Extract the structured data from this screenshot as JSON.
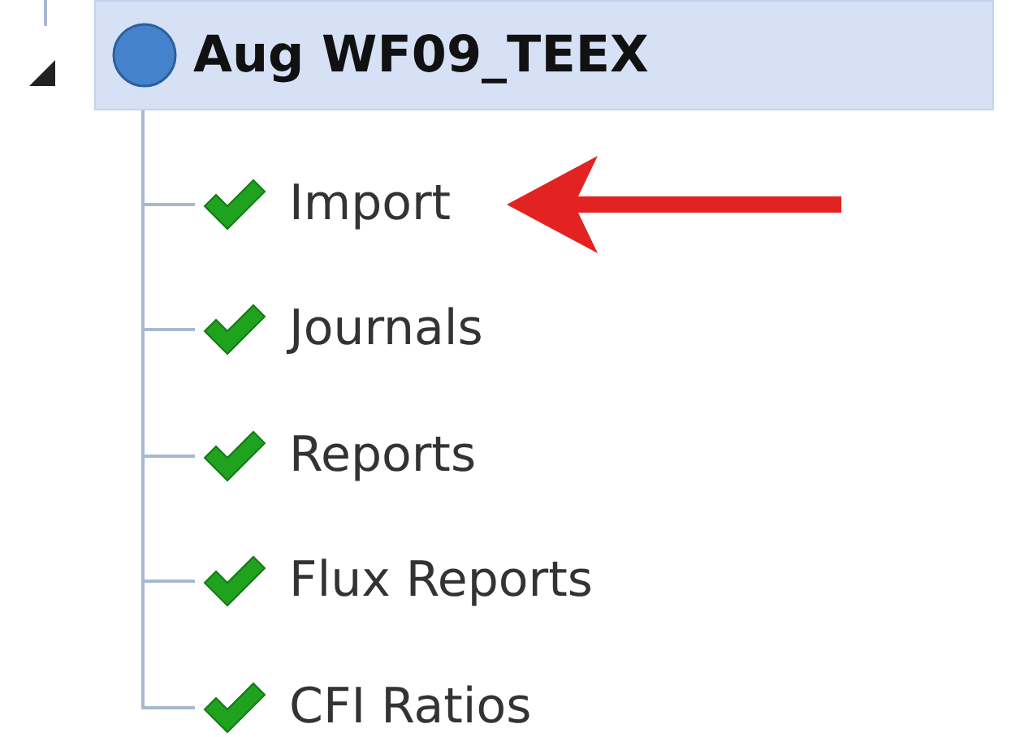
{
  "tree": {
    "label": "Aug WF09_TEEX",
    "expanded": true,
    "selected": true,
    "children": [
      {
        "label": "Import",
        "complete": true,
        "pointer": true
      },
      {
        "label": "Journals",
        "complete": true,
        "pointer": false
      },
      {
        "label": "Reports",
        "complete": true,
        "pointer": false
      },
      {
        "label": "Flux Reports",
        "complete": true,
        "pointer": false
      },
      {
        "label": "CFI Ratios",
        "complete": true,
        "pointer": false
      }
    ]
  }
}
